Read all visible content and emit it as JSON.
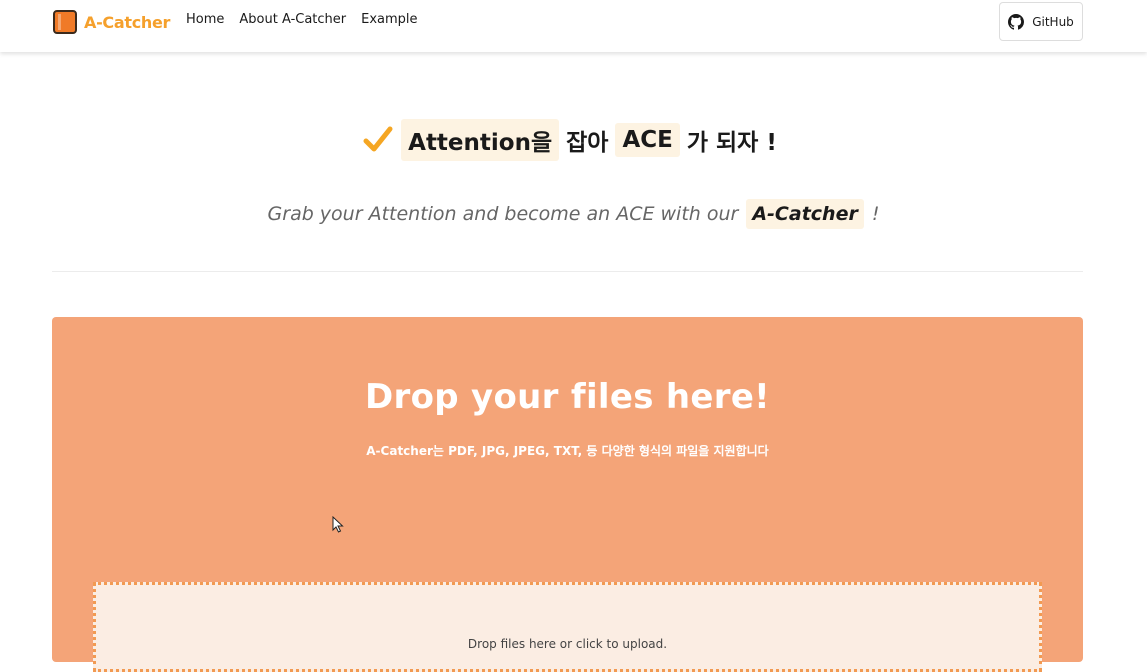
{
  "navbar": {
    "brand": "A-Catcher",
    "links": [
      "Home",
      "About A-Catcher",
      "Example"
    ],
    "github_label": "GitHub"
  },
  "hero": {
    "title_highlight_1": "Attention을",
    "title_plain_1": "잡아",
    "title_highlight_2": "ACE",
    "title_plain_2": "가 되자 !",
    "subtitle_prefix": "Grab your Attention and become an ACE with our",
    "subtitle_highlight": "A-Catcher",
    "subtitle_suffix": "!"
  },
  "upload": {
    "title": "Drop your files here!",
    "description": "A-Catcher는 PDF, JPG, JPEG, TXT, 등 다양한 형식의 파일을 지원합니다",
    "dropzone_text": "Drop files here or click to upload."
  },
  "colors": {
    "brand": "#f5a02c",
    "panel": "#f4a478",
    "highlight": "#fdf3e2",
    "check": "#f5a623"
  },
  "icons": {
    "brand_logo": "book-icon",
    "github": "github-icon",
    "check": "check-icon"
  }
}
